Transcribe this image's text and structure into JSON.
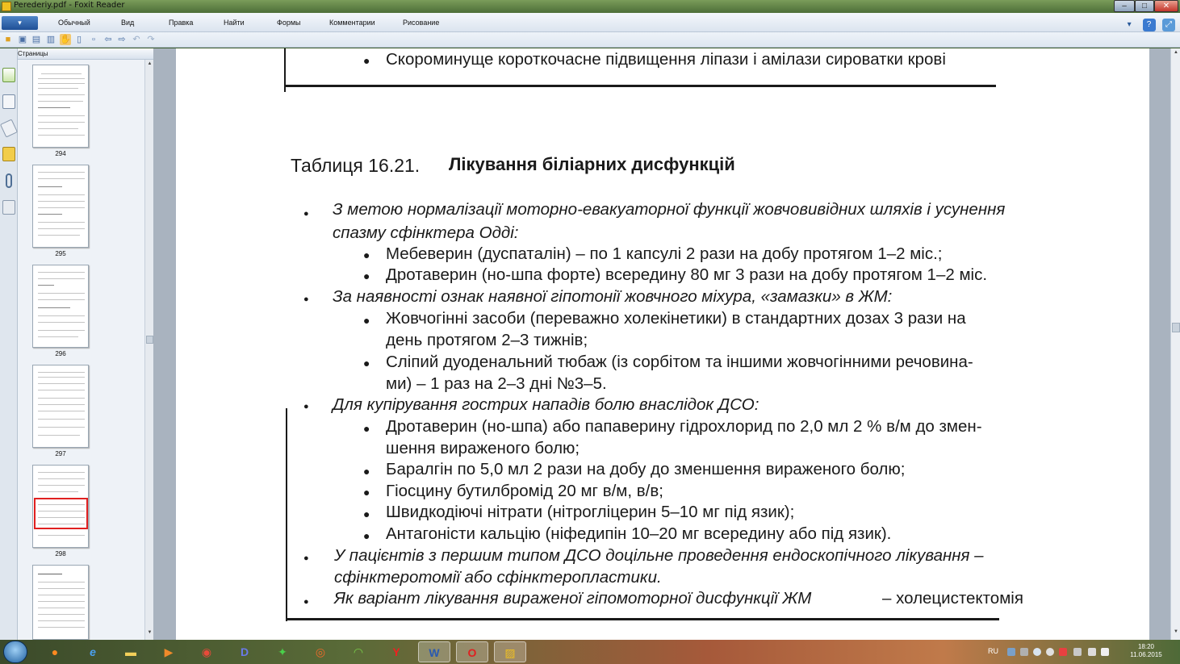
{
  "window": {
    "title": "Perederiy.pdf - Foxit Reader",
    "min_label": "–",
    "max_label": "□",
    "close_label": "✕"
  },
  "menu": {
    "app_button_label": "▾",
    "items": [
      "Обычный",
      "Вид",
      "Правка",
      "Найти",
      "Формы",
      "Комментарии",
      "Рисование"
    ],
    "help_label": "?"
  },
  "panel": {
    "title": "Страницы",
    "collapse_label": "◂",
    "thumbnails": [
      {
        "page": "294"
      },
      {
        "page": "295"
      },
      {
        "page": "296"
      },
      {
        "page": "297"
      },
      {
        "page": "298"
      }
    ]
  },
  "document": {
    "top_bullet": "Скороминуще короткочасне підвищення ліпази і амілази сироватки крові",
    "table_prefix": "Таблиця 16.21.",
    "table_title": "Лікування біліарних дисфункцій",
    "lines": [
      "З метою нормалізації моторно-евакуаторної функції жовчовивідних шляхів і усунення",
      "спазму сфінктера Одді:",
      "Мебеверин (дуспаталін) – по 1 капсулі 2 рази на добу протягом 1–2 міс.;",
      "Дротаверин (но-шпа форте) всередину 80 мг 3 рази на добу протягом 1–2 міс.",
      "За наявності ознак наявної гіпотонії жовчного міхура, «замазки» в ЖМ:",
      "Жовчогінні засоби (переважно холекінетики) в стандартних дозах 3 рази на",
      "день протягом 2–3 тижнів;",
      "Сліпий дуоденальний тюбаж (із сорбітом та іншими жовчогінними речовина-",
      "ми) – 1 раз на 2–3 дні №3–5.",
      "Для купірування гострих нападів болю внаслідок ДСО:",
      "Дротаверин (но-шпа) або папаверину гідрохлорид по 2,0 мл 2 % в/м до змен-",
      "шення вираженого болю;",
      "Баралгін по 5,0 мл 2 рази на добу до зменшення вираженого болю;",
      "Гіосцину бутилбромід 20 мг в/м, в/в;",
      "Швидкодіючі нітрати (нітрогліцерин 5–10 мг під язик);",
      "Антагоністи кальцію (ніфедипін 10–20 мг всередину або під язик).",
      "У пацієнтів з першим типом ДСО доцільне проведення ендоскопічного лікування –",
      "сфінктеротомії або сфінктеропластики.",
      "Як варіант лікування вираженої гіпомоторної дисфункції ЖМ",
      "– холецистектомія"
    ]
  },
  "taskbar": {
    "apps": [
      "firefox-icon",
      "ie-icon",
      "explorer-icon",
      "media-icon",
      "chrome-icon",
      "d-app-icon",
      "butterfly-icon",
      "eye-app-icon",
      "wifi-app-icon",
      "yandex-icon",
      "word-icon",
      "opera-icon",
      "foxit-icon"
    ],
    "word_label": "W",
    "lang": "RU",
    "time": "18:20",
    "date": "11.06.2015"
  }
}
